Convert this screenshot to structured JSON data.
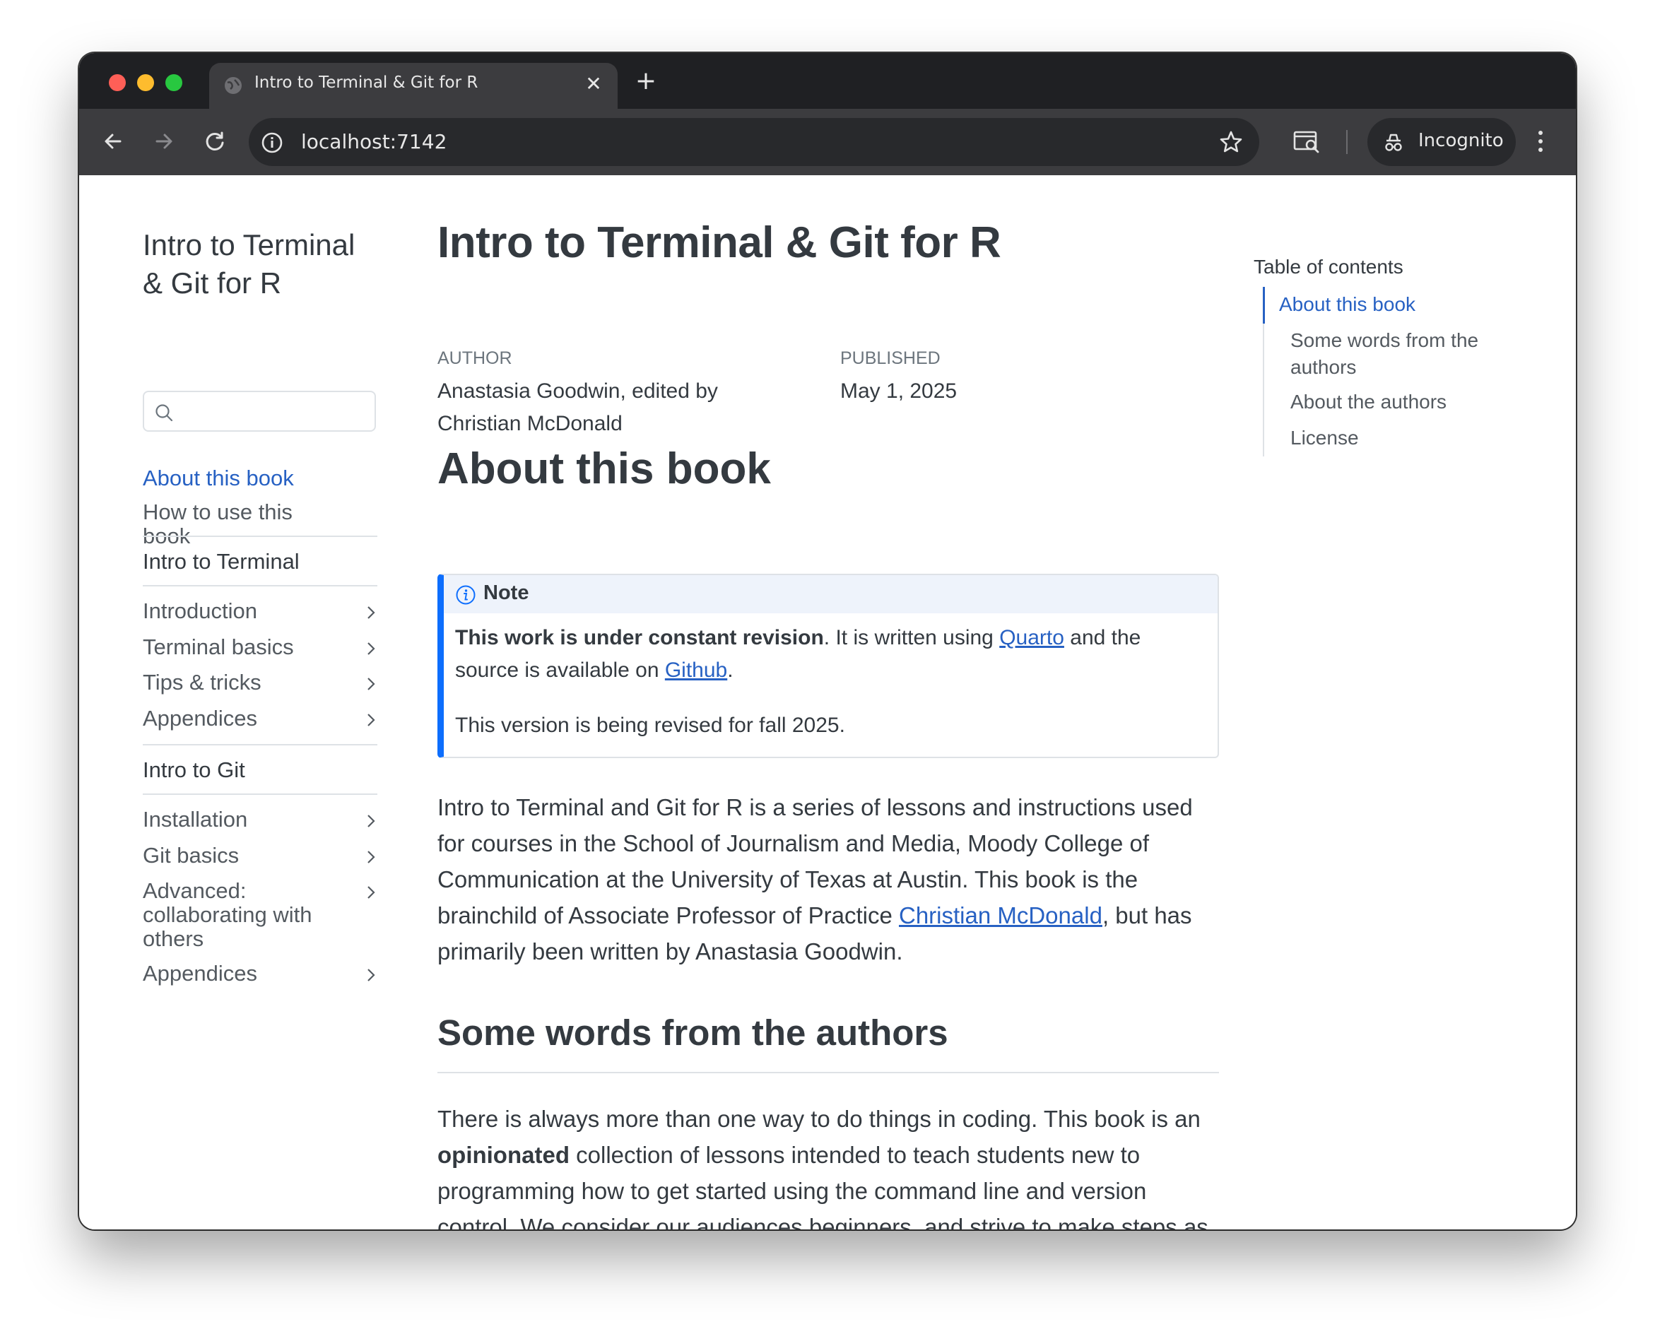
{
  "browser": {
    "tab_title": "Intro to Terminal & Git for R",
    "tab_close": "✕",
    "new_tab": "+",
    "url": "localhost:7142",
    "profile_label": "Incognito"
  },
  "sidebar": {
    "book_title": "Intro to Terminal & Git for R",
    "search_placeholder": "",
    "items": [
      {
        "label": "About this book",
        "active": true
      },
      {
        "label": "How to use this book"
      },
      {
        "label": "Intro to Terminal",
        "section": true
      },
      {
        "label": "Introduction",
        "expandable": true
      },
      {
        "label": "Terminal basics",
        "expandable": true
      },
      {
        "label": "Tips & tricks",
        "expandable": true
      },
      {
        "label": "Appendices",
        "expandable": true
      },
      {
        "label": "Intro to Git",
        "section": true
      },
      {
        "label": "Installation",
        "expandable": true
      },
      {
        "label": "Git basics",
        "expandable": true
      },
      {
        "label": "Advanced: collaborating with others",
        "expandable": true
      },
      {
        "label": "Appendices",
        "expandable": true
      }
    ]
  },
  "content": {
    "title": "Intro to Terminal & Git for R",
    "author_heading": "AUTHOR",
    "author": "Anastasia Goodwin, edited by Christian McDonald",
    "published_heading": "PUBLISHED",
    "published": "May 1, 2025",
    "section_title": "About this book",
    "callout": {
      "title": "Note",
      "bold_lead": "This work is under constant revision",
      "text_1": ". It is written using ",
      "link_quarto": "Quarto",
      "text_2": " and the source is available on ",
      "link_github": "Github",
      "text_3": ".",
      "revision_note": "This version is being revised for fall 2025."
    },
    "intro": {
      "text_1": "Intro to Terminal and Git for R is a series of lessons and instructions used for courses in the School of Journalism and Media, Moody College of Communication at the University of Texas at Austin. This book is the brainchild of Associate Professor of Practice ",
      "link": "Christian McDonald",
      "text_2": ", but has primarily been written by Anastasia Goodwin."
    },
    "subsection_title": "Some words from the authors",
    "words": {
      "text_1": "There is always more than one way to do things in coding. This book is an ",
      "bold": "opinionated",
      "text_2": " collection of lessons intended to teach students new to programming how to get started using the command line and version control. We consider our audiences beginners, and strive to make steps as simple as possible, which means we may not go into detail about alternative (and"
    }
  },
  "toc": {
    "title": "Table of contents",
    "items": [
      {
        "label": "About this book",
        "active": true
      },
      {
        "label": "Some words from the authors"
      },
      {
        "label": "About the authors"
      },
      {
        "label": "License"
      }
    ]
  },
  "colors": {
    "link": "#2761c3",
    "callout_accent": "#0d6efd",
    "text": "#343a40",
    "chrome_dark": "#1f2023",
    "chrome_toolbar": "#3c3c3f"
  }
}
